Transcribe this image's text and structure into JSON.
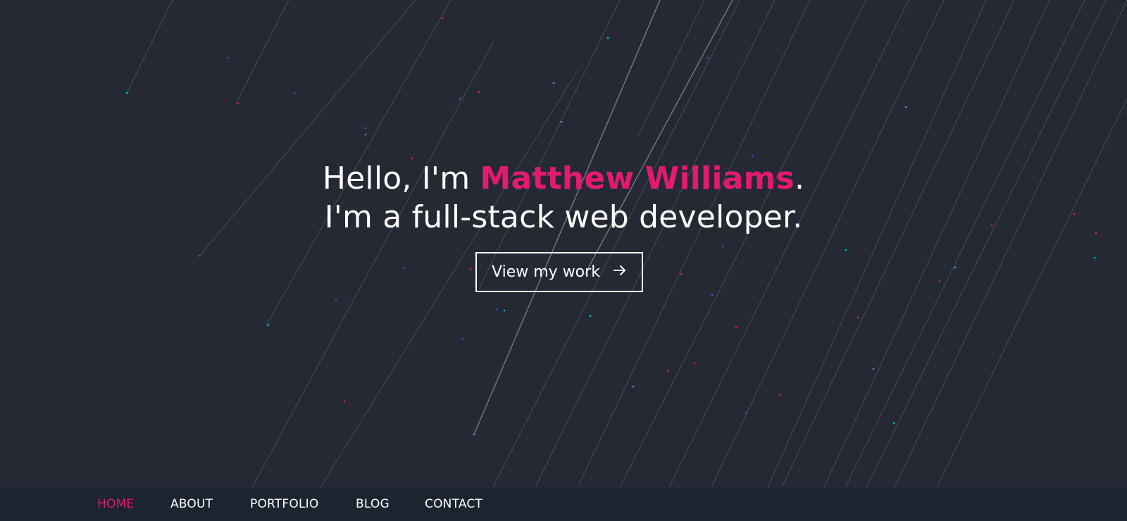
{
  "hero": {
    "greeting": "Hello, I'm ",
    "name": "Matthew Williams",
    "period": ".",
    "tagline": "I'm a full-stack web developer.",
    "cta_label": "View my work",
    "cta_icon": "arrow-right-icon"
  },
  "nav": {
    "items": [
      {
        "label": "HOME",
        "active": true
      },
      {
        "label": "ABOUT",
        "active": false
      },
      {
        "label": "PORTFOLIO",
        "active": false
      },
      {
        "label": "BLOG",
        "active": false
      },
      {
        "label": "CONTACT",
        "active": false
      }
    ]
  },
  "colors": {
    "background": "#252934",
    "accent": "#e31b6d",
    "nav_background": "#1b242f",
    "text": "#ffffff",
    "dot_teal": "#04c2c9",
    "dot_blue": "#2e4f9e"
  }
}
